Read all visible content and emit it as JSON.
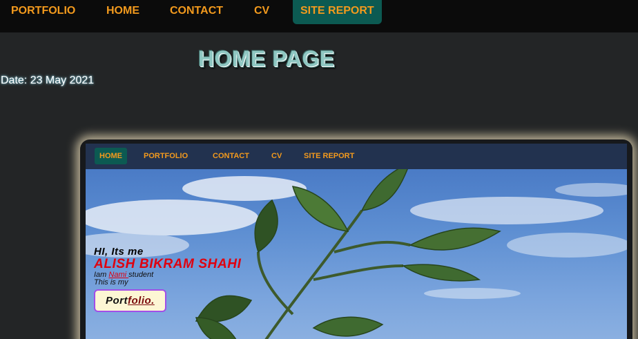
{
  "topnav": {
    "items": [
      {
        "label": "PORTFOLIO"
      },
      {
        "label": "HOME"
      },
      {
        "label": "CONTACT"
      },
      {
        "label": "CV"
      },
      {
        "label": "SITE REPORT"
      }
    ]
  },
  "page": {
    "title": "HOME PAGE",
    "date": "Date: 23 May 2021"
  },
  "preview": {
    "nav": [
      {
        "label": "HOME"
      },
      {
        "label": "PORTFOLIO"
      },
      {
        "label": "CONTACT"
      },
      {
        "label": "CV"
      },
      {
        "label": "SITE REPORT"
      }
    ],
    "greeting": "HI, Its me",
    "name": "ALISH BIKRAM SHAHI",
    "line1_pre": "Iam ",
    "line1_highlight": "Nami ",
    "line1_post": "student",
    "line2": "This is my",
    "button_part1": "Port",
    "button_part2": "folio."
  },
  "colors": {
    "nav_text": "#f39a1d",
    "nav_active_bg": "#0c5a52",
    "name_red": "#e0000e",
    "button_border": "#a24de8"
  }
}
